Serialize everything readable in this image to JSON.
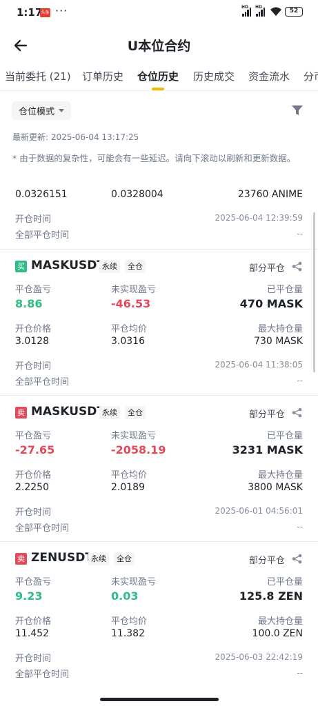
{
  "status": {
    "time": "1:17",
    "app_badge": "头条",
    "battery": "52"
  },
  "header": {
    "title": "U本位合约"
  },
  "tabs": [
    {
      "label": "当前委托 (21)"
    },
    {
      "label": "订单历史"
    },
    {
      "label": "仓位历史"
    },
    {
      "label": "历史成交"
    },
    {
      "label": "资金流水"
    },
    {
      "label": "分币"
    }
  ],
  "filter": {
    "mode_label": "仓位模式"
  },
  "update": "最新更新: 2025-06-04 13:17:25",
  "note": "* 由于数据的复杂性，可能会有一些延迟。请向下滚动以刷新和更新数据。",
  "labels": {
    "close_pnl": "平仓盈亏",
    "unrealized_pnl": "未实现盈亏",
    "closed_qty": "已平仓量",
    "open_price": "开仓价格",
    "avg_close": "平仓均价",
    "max_hold": "最大持仓量",
    "open_time": "开仓时间",
    "full_close_time": "全部平仓时间"
  },
  "previous": {
    "v1": "0.0326151",
    "v2": "0.0328004",
    "v3": "23760 ANIME",
    "open_time": "2025-06-04 12:39:59",
    "full_close_time": "--"
  },
  "positions": [
    {
      "side": "买",
      "side_type": "buy",
      "symbol": "MASKUSDT",
      "tag1": "永续",
      "tag2": "全仓",
      "status": "部分平仓",
      "close_pnl": "8.86",
      "close_pnl_color": "green",
      "unrealized_pnl": "-46.53",
      "unrealized_color": "red",
      "closed_qty": "470 MASK",
      "open_price": "3.0128",
      "avg_close": "3.0316",
      "max_hold": "730 MASK",
      "open_time": "2025-06-04 11:38:05",
      "full_close_time": "--"
    },
    {
      "side": "卖",
      "side_type": "sell",
      "symbol": "MASKUSDT",
      "tag1": "永续",
      "tag2": "全仓",
      "status": "部分平仓",
      "close_pnl": "-27.65",
      "close_pnl_color": "red",
      "unrealized_pnl": "-2058.19",
      "unrealized_color": "red",
      "closed_qty": "3231 MASK",
      "open_price": "2.2250",
      "avg_close": "2.0189",
      "max_hold": "3800 MASK",
      "open_time": "2025-06-01 04:56:01",
      "full_close_time": "--"
    },
    {
      "side": "卖",
      "side_type": "sell",
      "symbol": "ZENUSDT",
      "tag1": "永续",
      "tag2": "全仓",
      "status": "部分平仓",
      "close_pnl": "9.23",
      "close_pnl_color": "green",
      "unrealized_pnl": "0.03",
      "unrealized_color": "green",
      "closed_qty": "125.8 ZEN",
      "open_price": "11.452",
      "avg_close": "11.382",
      "max_hold": "100.0 ZEN",
      "open_time": "2025-06-03 22:42:19",
      "full_close_time": "--"
    }
  ],
  "colors": {
    "accent": "#f0b90b",
    "buy": "#2ebd85",
    "sell": "#e24a5a"
  }
}
